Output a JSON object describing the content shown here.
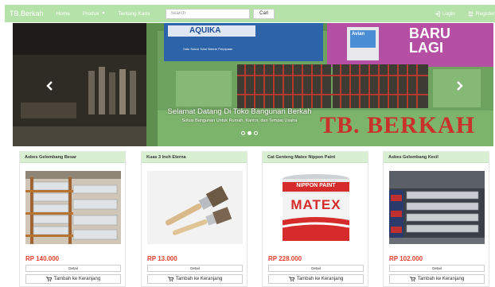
{
  "navbar": {
    "brand": "TB.Berkah",
    "links": [
      "Home",
      "Produk",
      "Tentang Kami"
    ],
    "search_placeholder": "Search",
    "search_button": "Cari",
    "login": "Login",
    "register": "Register"
  },
  "carousel": {
    "caption_title": "Selamat Datang Di Toko Bangunan Berkah",
    "caption_text": "Solusi Bangunan Untuk Rumah, Kantor, dan Tempat Usaha",
    "signboard": "TB. BERKAH",
    "banner_left": "AQUIKA",
    "banner_left_sub": "Satu Solusi Total Sistem Perpipaan",
    "banner_right_brand": "Avian",
    "banner_right_text": "BARU LAGI",
    "slide_count": 3,
    "active_slide": 1
  },
  "products": [
    {
      "name": "Asbes Gelombang Besar",
      "price": "RP 140.000",
      "detail": "Detail",
      "cart": "Tambah ke Keranjang"
    },
    {
      "name": "Kuas 3 Inch Eterna",
      "price": "RP 13.000",
      "detail": "Detail",
      "cart": "Tambah ke Keranjang"
    },
    {
      "name": "Cat Genteng Matex Nippon Paint",
      "price": "RP 228.000",
      "detail": "Detail",
      "cart": "Tambah ke Keranjang",
      "can_brand": "NIPPON PAINT",
      "can_label": "MATEX"
    },
    {
      "name": "Asbes Gelombang Kecil",
      "price": "RP 102.000",
      "detail": "Detail",
      "cart": "Tambah ke Keranjang"
    }
  ],
  "colors": {
    "navbar": "#b5e2a9",
    "card_header": "#d8efd2",
    "price": "#e0402e",
    "wall_green": "#6ea35f",
    "sign_red": "#c9312a"
  }
}
